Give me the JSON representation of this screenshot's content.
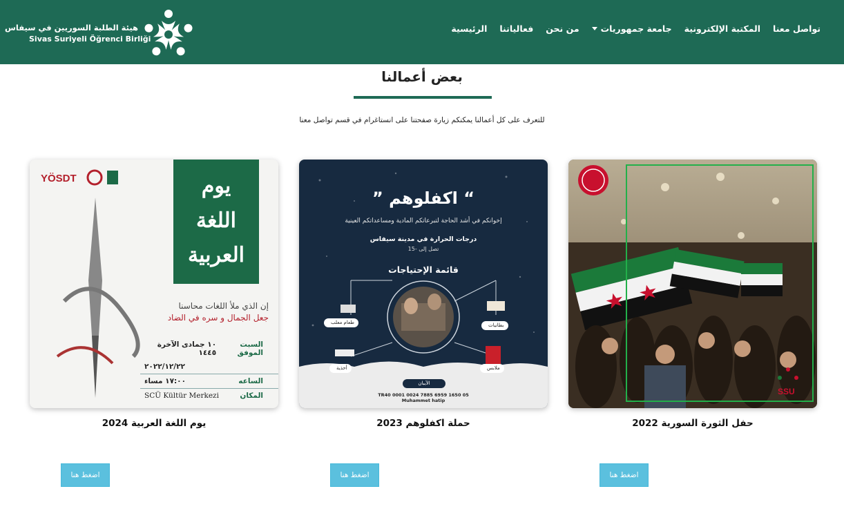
{
  "brand": {
    "name_ar": "هيئة الطلبة السوريين في سيفاس",
    "name_tr": "Sivas Suriyeli Öğrenci Birliği"
  },
  "nav": {
    "home": "الرئيسية",
    "events": "فعالياتنا",
    "about": "من نحن",
    "university": "جامعة جمهوريات",
    "library": "المكتبة الإلكترونية",
    "contact": "تواصل معنا"
  },
  "section": {
    "title": "بعض أعمالنا",
    "subtitle": "للتعرف على كل أعمالنا يمكنكم زيارة صفحتنا على انستاغرام في قسم تواصل معنا"
  },
  "cards": [
    {
      "title": "يوم اللغة العربية 2024",
      "button": "اضغط هنا",
      "poster": {
        "heading_l1": "يوم",
        "heading_l2": "اللغة",
        "heading_l3": "العربية",
        "verse_l1": "إن الذي ملأ اللغات محاسنا",
        "verse_l2": "جعل الجمال و سره في الضاد",
        "date_label": "السبت الموفق",
        "date_value": "١٠ جمادى الآخرة ١٤٤٥",
        "date_value2": "٢٠٢٢/١٢/٢٢",
        "time_label": "الساعه",
        "time_value": "١٧:٠٠ مساء",
        "place_label": "المكان",
        "place_value": "SCÜ Kültür Merkezi",
        "logo_text": "YÖSDT"
      }
    },
    {
      "title": "حملة اكفلوهم 2023",
      "button": "اضغط هنا",
      "poster": {
        "heading": "اكفلوهم",
        "line1": "إخوانكم في أشد الحاجة لتبرعاتكم المادية ومساعداتكم العينية",
        "line2": "درجات الحرارة في مدينة سيفاس",
        "line3": "تصل إلى -15",
        "list_title": "قائمة الإحتياجات",
        "chip_food": "طعام معلب",
        "chip_blankets": "بطانيات",
        "chip_shoes": "أحذية",
        "chip_clothes": "ملابس",
        "pill": "الآيبان",
        "iban": "TR40 0001 0024 7885 6959 1650 05",
        "holder": "Muhammet hatip"
      }
    },
    {
      "title": "حفل الثورة السورية 2022",
      "button": "اضغط هنا",
      "poster": {
        "logo_text": "SSU"
      }
    }
  ],
  "colors": {
    "primary": "#1e6a55",
    "button": "#5bc0de",
    "poster_green": "#1c6a47",
    "poster_dark": "#172a40",
    "accent_red": "#b3202c"
  }
}
